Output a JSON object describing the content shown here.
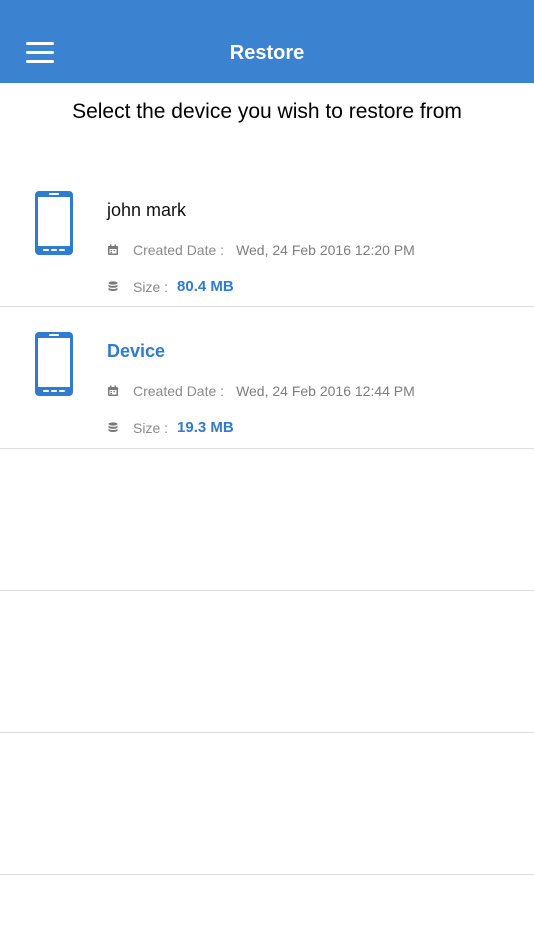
{
  "header": {
    "title": "Restore",
    "menu_icon": "hamburger-menu-icon"
  },
  "instruction": "Select the device you wish to restore from",
  "colors": {
    "header_bg": "#3b82d0",
    "accent": "#2e7bcf"
  },
  "devices": [
    {
      "name": "john mark",
      "created_label": "Created Date :",
      "created_value": "Wed, 24 Feb 2016 12:20 PM",
      "size_label": "Size :",
      "size_value": "80.4 MB"
    },
    {
      "name": "Device",
      "created_label": "Created Date :",
      "created_value": "Wed, 24 Feb 2016 12:44 PM",
      "size_label": "Size :",
      "size_value": "19.3 MB"
    }
  ]
}
